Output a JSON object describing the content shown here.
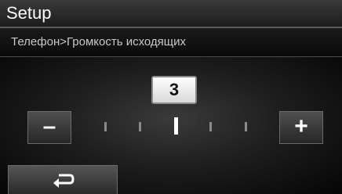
{
  "header": {
    "title": "Setup",
    "breadcrumb": "Телефон>Громкость исходящих"
  },
  "volume": {
    "value": "3",
    "level": 3,
    "max_level": 5,
    "minus_label": "–",
    "plus_label": "+"
  },
  "footer": {
    "back_icon": "return-arrow-icon"
  }
}
